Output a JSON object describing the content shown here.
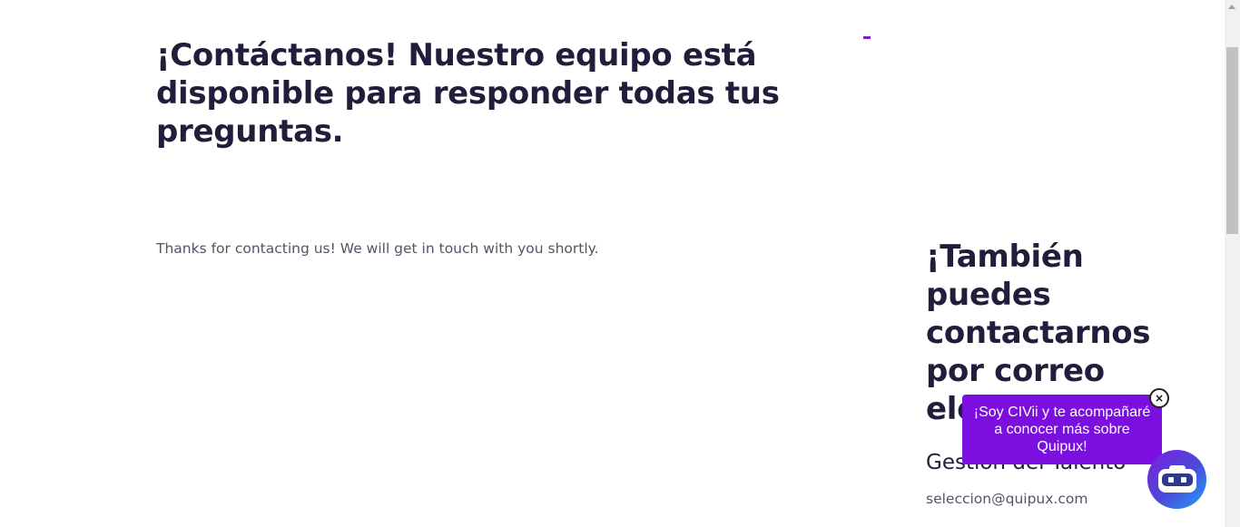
{
  "hero": {
    "heading": "¡Contáctanos! Nuestro equipo está disponible para responder todas tus preguntas."
  },
  "form": {
    "confirmation": "Thanks for contacting us! We will get in touch with you shortly."
  },
  "contact": {
    "heading": "¡También puedes contactarnos por correo electrónico!",
    "department": "Gestión del Talento",
    "email": "seleccion@quipux.com"
  },
  "chat": {
    "bubble_text": "¡Soy CIVii y te acompañaré a conocer más sobre Quipux!",
    "close_symbol": "×",
    "bot_icon": "robot-icon",
    "bubble_color": "#7a0fe0"
  },
  "colors": {
    "heading": "#221d3b",
    "body_text": "#555466",
    "accent": "#7a1fd6"
  }
}
